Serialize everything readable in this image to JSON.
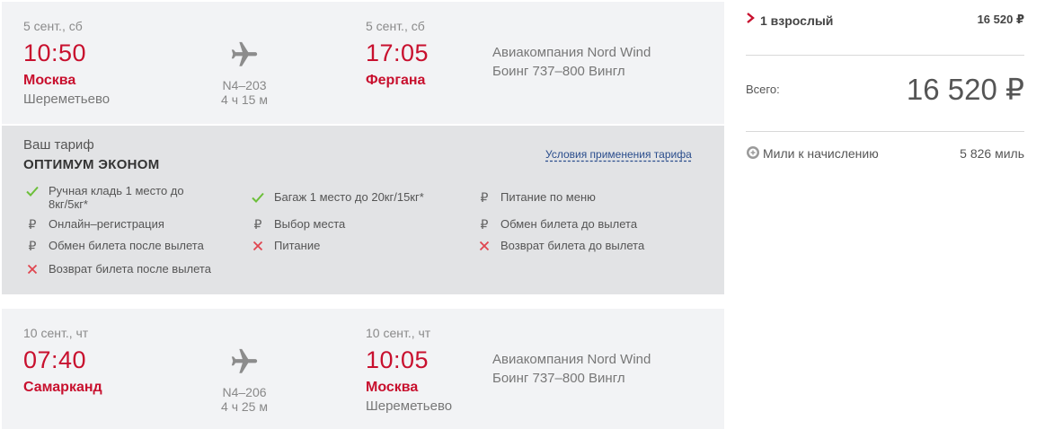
{
  "outbound": {
    "dep_date": "5 сент., сб",
    "dep_time": "10:50",
    "dep_city": "Москва",
    "dep_airport": "Шереметьево",
    "flight_no": "N4–203",
    "duration": "4 ч 15 м",
    "arr_date": "5 сент., сб",
    "arr_time": "17:05",
    "arr_city": "Фергана",
    "airline": "Авиакомпания Nord Wind",
    "aircraft": "Боинг 737–800 Вингл"
  },
  "fare": {
    "label": "Ваш тариф",
    "name": "ОПТИМУМ ЭКОНОМ",
    "conditions_link": "Условия применения тарифа",
    "features": [
      {
        "icon": "check-icon",
        "text": "Ручная кладь  1 место до 8кг/5кг*"
      },
      {
        "icon": "check-icon",
        "text": "Багаж  1 место до 20кг/15кг*"
      },
      {
        "icon": "ruble-icon",
        "text": "Питание по меню"
      },
      {
        "icon": "ruble-icon",
        "text": "Онлайн–регистрация"
      },
      {
        "icon": "ruble-icon",
        "text": "Выбор места"
      },
      {
        "icon": "ruble-icon",
        "text": "Обмен билета до вылета"
      },
      {
        "icon": "ruble-icon",
        "text": "Обмен билета после вылета"
      },
      {
        "icon": "cross-icon",
        "text": "Питание"
      },
      {
        "icon": "cross-icon",
        "text": "Возврат билета до вылета"
      },
      {
        "icon": "cross-icon",
        "text": "Возврат билета после вылета"
      }
    ]
  },
  "inbound": {
    "dep_date": "10 сент., чт",
    "dep_time": "07:40",
    "dep_city": "Самарканд",
    "flight_no": "N4–206",
    "duration": "4 ч 25 м",
    "arr_date": "10 сент., чт",
    "arr_time": "10:05",
    "arr_city": "Москва",
    "arr_airport": "Шереметьево",
    "airline": "Авиакомпания Nord Wind",
    "aircraft": "Боинг 737–800 Вингл"
  },
  "summary": {
    "passengers": "1 взрослый",
    "passengers_price": "16 520 ₽",
    "total_label": "Всего:",
    "total_price": "16 520 ₽",
    "miles_label": "Мили к начислению",
    "miles_value": "5 826 миль"
  },
  "colors": {
    "accent_red": "#c8102e",
    "check_green": "#6cbf3a",
    "cross_red": "#e0454f",
    "link_blue": "#2a4d8c"
  }
}
